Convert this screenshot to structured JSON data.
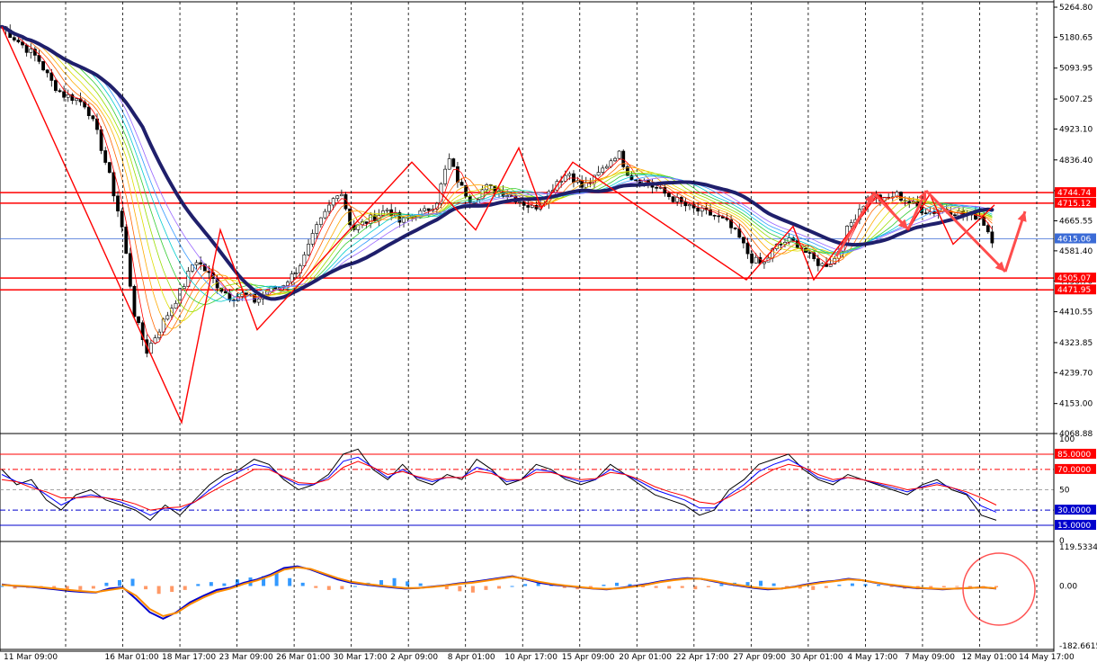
{
  "chart_data": [
    {
      "type": "candlestick",
      "panel": "price",
      "ylim": [
        4068.88,
        5264.8
      ],
      "y_ticks": [
        "5264.80",
        "5180.65",
        "5093.95",
        "5007.25",
        "4923.10",
        "4836.40",
        "4750.25",
        "4665.55",
        "4581.40",
        "4496.70",
        "4410.55",
        "4323.85",
        "4239.70",
        "4153.00",
        "4068.88"
      ],
      "x_ticks": [
        "11 Mar 09:00",
        "16 Mar 01:00",
        "18 Mar 17:00",
        "23 Mar 09:00",
        "26 Mar 01:00",
        "30 Mar 17:00",
        "2 Apr 09:00",
        "8 Apr 01:00",
        "10 Apr 17:00",
        "15 Apr 09:00",
        "20 Apr 01:00",
        "22 Apr 17:00",
        "27 Apr 09:00",
        "30 Apr 01:00",
        "4 May 17:00",
        "7 May 09:00",
        "12 May 01:00",
        "14 May 17:00"
      ],
      "close_path": [
        5210,
        5180,
        5150,
        5120,
        5060,
        5020,
        5010,
        4990,
        4900,
        4780,
        4640,
        4400,
        4300,
        4360,
        4420,
        4480,
        4560,
        4520,
        4480,
        4450,
        4460,
        4440,
        4470,
        4480,
        4510,
        4560,
        4640,
        4700,
        4760,
        4640,
        4660,
        4680,
        4700,
        4660,
        4680,
        4690,
        4720,
        4840,
        4760,
        4720,
        4760,
        4750,
        4740,
        4720,
        4700,
        4730,
        4780,
        4800,
        4760,
        4780,
        4820,
        4860,
        4790,
        4780,
        4760,
        4740,
        4720,
        4700,
        4690,
        4680,
        4660,
        4620,
        4560,
        4540,
        4590,
        4610,
        4600,
        4560,
        4540,
        4560,
        4640,
        4700,
        4740,
        4720,
        4740,
        4720,
        4700,
        4690,
        4700,
        4690,
        4680,
        4680,
        4615
      ],
      "horizontal_levels": [
        {
          "label": "4744.74",
          "value": 4744.74,
          "color": "#ff0000"
        },
        {
          "label": "4715.12",
          "value": 4715.12,
          "color": "#ff0000"
        },
        {
          "label": "4615.06",
          "value": 4615.06,
          "color": "#3b6bd6"
        },
        {
          "label": "4505.07",
          "value": 4505.07,
          "color": "#ff0000"
        },
        {
          "label": "4471.95",
          "value": 4471.95,
          "color": "#ff0000"
        }
      ],
      "zigzag": [
        5210,
        4100,
        4640,
        4360,
        4830,
        4640,
        4870,
        4700,
        4830,
        4500,
        4650,
        4500,
        4740,
        4640,
        4740,
        4600,
        4710
      ],
      "ma_color": "#1f1f6b",
      "zigzag_color": "#ff0000",
      "arrow_color": "#ff4d4d"
    },
    {
      "type": "line",
      "panel": "stochastic",
      "ylim": [
        0,
        100
      ],
      "y_ticks": [
        "100",
        "50",
        "0"
      ],
      "levels": [
        {
          "label": "85.0000",
          "value": 85,
          "color": "#ff0000"
        },
        {
          "label": "70.0000",
          "value": 70,
          "color": "#ff0000"
        },
        {
          "label": "30.0000",
          "value": 30,
          "color": "#0000cc"
        },
        {
          "label": "15.0000",
          "value": 15,
          "color": "#0000cc"
        }
      ],
      "series": [
        {
          "values": [
            70,
            55,
            60,
            40,
            30,
            45,
            50,
            40,
            35,
            30,
            20,
            35,
            25,
            40,
            55,
            65,
            70,
            80,
            75,
            60,
            50,
            55,
            65,
            85,
            90,
            70,
            60,
            75,
            60,
            55,
            65,
            60,
            80,
            70,
            55,
            60,
            75,
            70,
            60,
            55,
            60,
            75,
            65,
            55,
            45,
            40,
            35,
            25,
            30,
            50,
            60,
            75,
            80,
            85,
            70,
            60,
            55,
            65,
            60,
            55,
            50,
            45,
            55,
            60,
            50,
            45,
            25,
            20
          ],
          "color": "#000000"
        },
        {
          "values": [
            65,
            58,
            55,
            45,
            35,
            42,
            45,
            42,
            38,
            32,
            25,
            32,
            30,
            38,
            50,
            60,
            68,
            75,
            72,
            62,
            55,
            55,
            62,
            78,
            82,
            72,
            62,
            70,
            62,
            58,
            62,
            62,
            72,
            68,
            58,
            60,
            70,
            68,
            62,
            58,
            60,
            70,
            65,
            58,
            50,
            45,
            40,
            32,
            32,
            45,
            55,
            68,
            75,
            80,
            72,
            62,
            58,
            62,
            60,
            56,
            52,
            48,
            53,
            57,
            52,
            46,
            34,
            28
          ],
          "color": "#0000ff"
        },
        {
          "values": [
            60,
            58,
            52,
            48,
            42,
            42,
            43,
            42,
            40,
            36,
            30,
            32,
            33,
            38,
            47,
            55,
            62,
            70,
            70,
            63,
            57,
            56,
            60,
            72,
            78,
            72,
            65,
            68,
            63,
            60,
            62,
            62,
            68,
            66,
            60,
            60,
            67,
            67,
            63,
            60,
            61,
            67,
            65,
            60,
            53,
            48,
            44,
            38,
            36,
            43,
            51,
            62,
            70,
            75,
            72,
            65,
            60,
            62,
            60,
            57,
            54,
            50,
            52,
            55,
            52,
            48,
            42,
            35
          ],
          "color": "#ff0000"
        }
      ]
    },
    {
      "type": "histogram",
      "panel": "macd",
      "ylim": [
        -182.6615,
        119.5334
      ],
      "y_ticks": [
        "119.5334",
        "0.00",
        "-182.6615"
      ],
      "histogram": [
        0,
        -8,
        -6,
        -4,
        -10,
        -14,
        -12,
        -8,
        10,
        18,
        22,
        -10,
        -24,
        -18,
        -12,
        6,
        12,
        8,
        20,
        26,
        30,
        40,
        24,
        10,
        -6,
        -12,
        -10,
        0,
        10,
        18,
        24,
        14,
        8,
        -4,
        -10,
        -16,
        -20,
        -12,
        -8,
        0,
        6,
        12,
        8,
        -6,
        -10,
        -4,
        4,
        10,
        6,
        -4,
        -6,
        -8,
        -6,
        -10,
        -4,
        6,
        10,
        12,
        16,
        8,
        -4,
        -8,
        -12,
        -6,
        4,
        8,
        6,
        4,
        -2,
        -8,
        -10,
        -6,
        -4,
        -2,
        -6,
        -8,
        -4
      ],
      "series": [
        {
          "values": [
            5,
            0,
            -2,
            -6,
            -10,
            -15,
            -18,
            -20,
            -8,
            -4,
            -40,
            -80,
            -100,
            -80,
            -50,
            -30,
            -12,
            -5,
            10,
            20,
            35,
            55,
            60,
            50,
            35,
            20,
            10,
            5,
            0,
            -4,
            -8,
            -6,
            -2,
            2,
            8,
            12,
            18,
            24,
            30,
            20,
            10,
            4,
            0,
            -4,
            -8,
            -10,
            -6,
            0,
            6,
            14,
            20,
            24,
            22,
            14,
            6,
            0,
            -6,
            -10,
            -8,
            -2,
            6,
            12,
            16,
            22,
            18,
            10,
            4,
            -2,
            -6,
            -8,
            -10,
            -8,
            -6,
            -4,
            -8
          ],
          "color": "#0000cc"
        },
        {
          "values": [
            3,
            1,
            -1,
            -4,
            -8,
            -12,
            -16,
            -19,
            -12,
            -6,
            -30,
            -70,
            -92,
            -82,
            -56,
            -35,
            -18,
            -8,
            6,
            17,
            31,
            50,
            57,
            52,
            38,
            24,
            13,
            7,
            2,
            -2,
            -6,
            -6,
            -3,
            1,
            6,
            10,
            16,
            22,
            28,
            22,
            13,
            6,
            1,
            -3,
            -7,
            -9,
            -7,
            -2,
            4,
            12,
            18,
            22,
            22,
            16,
            8,
            2,
            -4,
            -8,
            -8,
            -3,
            4,
            10,
            15,
            20,
            18,
            11,
            5,
            0,
            -5,
            -7,
            -9,
            -8,
            -6,
            -4,
            -7
          ],
          "color": "#ff8c00"
        }
      ]
    }
  ]
}
